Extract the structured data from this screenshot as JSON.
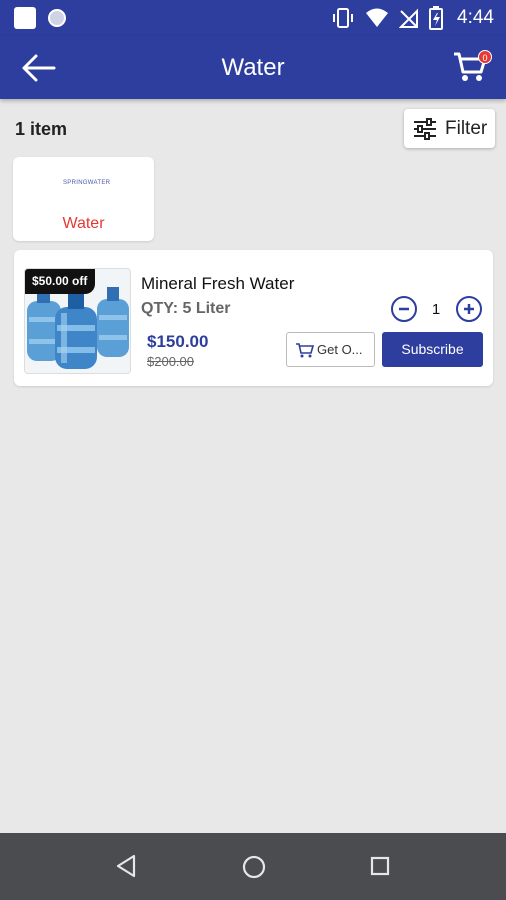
{
  "status_bar": {
    "time": "4:44",
    "icons": [
      "app-square-icon",
      "circle-icon",
      "vibrate-icon",
      "wifi-icon",
      "no-signal-icon",
      "battery-icon"
    ]
  },
  "app_bar": {
    "title": "Water",
    "back_icon": "arrow-left-icon",
    "cart_icon": "cart-icon",
    "cart_badge": "0"
  },
  "toolbar": {
    "count_label": "1 item",
    "filter_label": "Filter",
    "filter_icon": "sliders-icon"
  },
  "categories": [
    {
      "logo_text": "SPRINGWATER",
      "label": "Water"
    }
  ],
  "products": [
    {
      "name": "Mineral Fresh Water",
      "qty": "QTY: 5 Liter",
      "discount": "$50.00 off",
      "price": "$150.00",
      "old_price": "$200.00",
      "quantity": "1",
      "get_once_label": "Get O...",
      "subscribe_label": "Subscribe"
    }
  ],
  "nav_bar": {
    "icons": [
      "nav-back-icon",
      "nav-home-icon",
      "nav-recents-icon"
    ]
  },
  "colors": {
    "primary": "#2d3e9e",
    "accent_red": "#e53935",
    "background": "#e8e8e8",
    "nav_bar": "#4a4c50"
  }
}
